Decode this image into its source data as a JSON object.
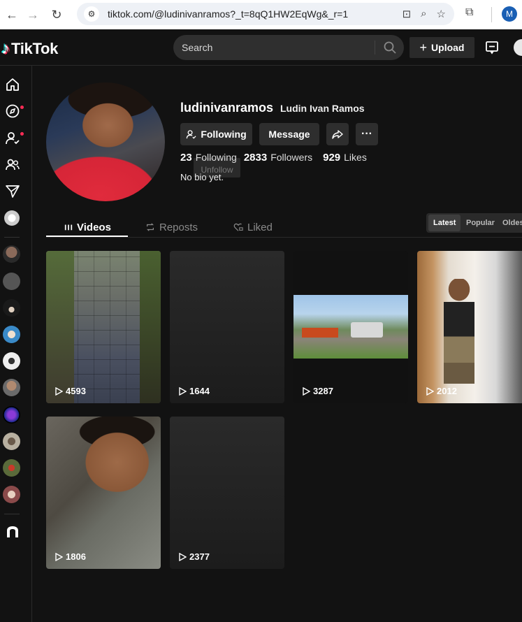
{
  "browser": {
    "url": "tiktok.com/@ludinivanramos?_t=8qQ1HW2EqWg&_r=1",
    "profile_initial": "M"
  },
  "header": {
    "logo_text": "TikTok",
    "search_placeholder": "Search",
    "upload_label": "Upload"
  },
  "profile": {
    "username": "ludinivanramos",
    "nickname": "Ludin Ivan Ramos",
    "following_button": "Following",
    "message_button": "Message",
    "following_count": "23",
    "following_label": "Following",
    "followers_count": "2833",
    "followers_label": "Followers",
    "likes_count": "929",
    "likes_label": "Likes",
    "unfollow_tooltip": "Unfollow",
    "bio": "No bio yet."
  },
  "tabs": [
    {
      "label": "Videos"
    },
    {
      "label": "Reposts"
    },
    {
      "label": "Liked"
    }
  ],
  "sort": {
    "options": [
      "Latest",
      "Popular",
      "Oldest"
    ],
    "selected": "Latest"
  },
  "videos": [
    {
      "views": "4593"
    },
    {
      "views": "1644"
    },
    {
      "views": "3287"
    },
    {
      "views": "2012"
    },
    {
      "views": "1806"
    },
    {
      "views": "2377"
    }
  ],
  "colors": {
    "background": "#121212",
    "notification_dot": "#fe2c55",
    "button": "#2e2e2e"
  }
}
